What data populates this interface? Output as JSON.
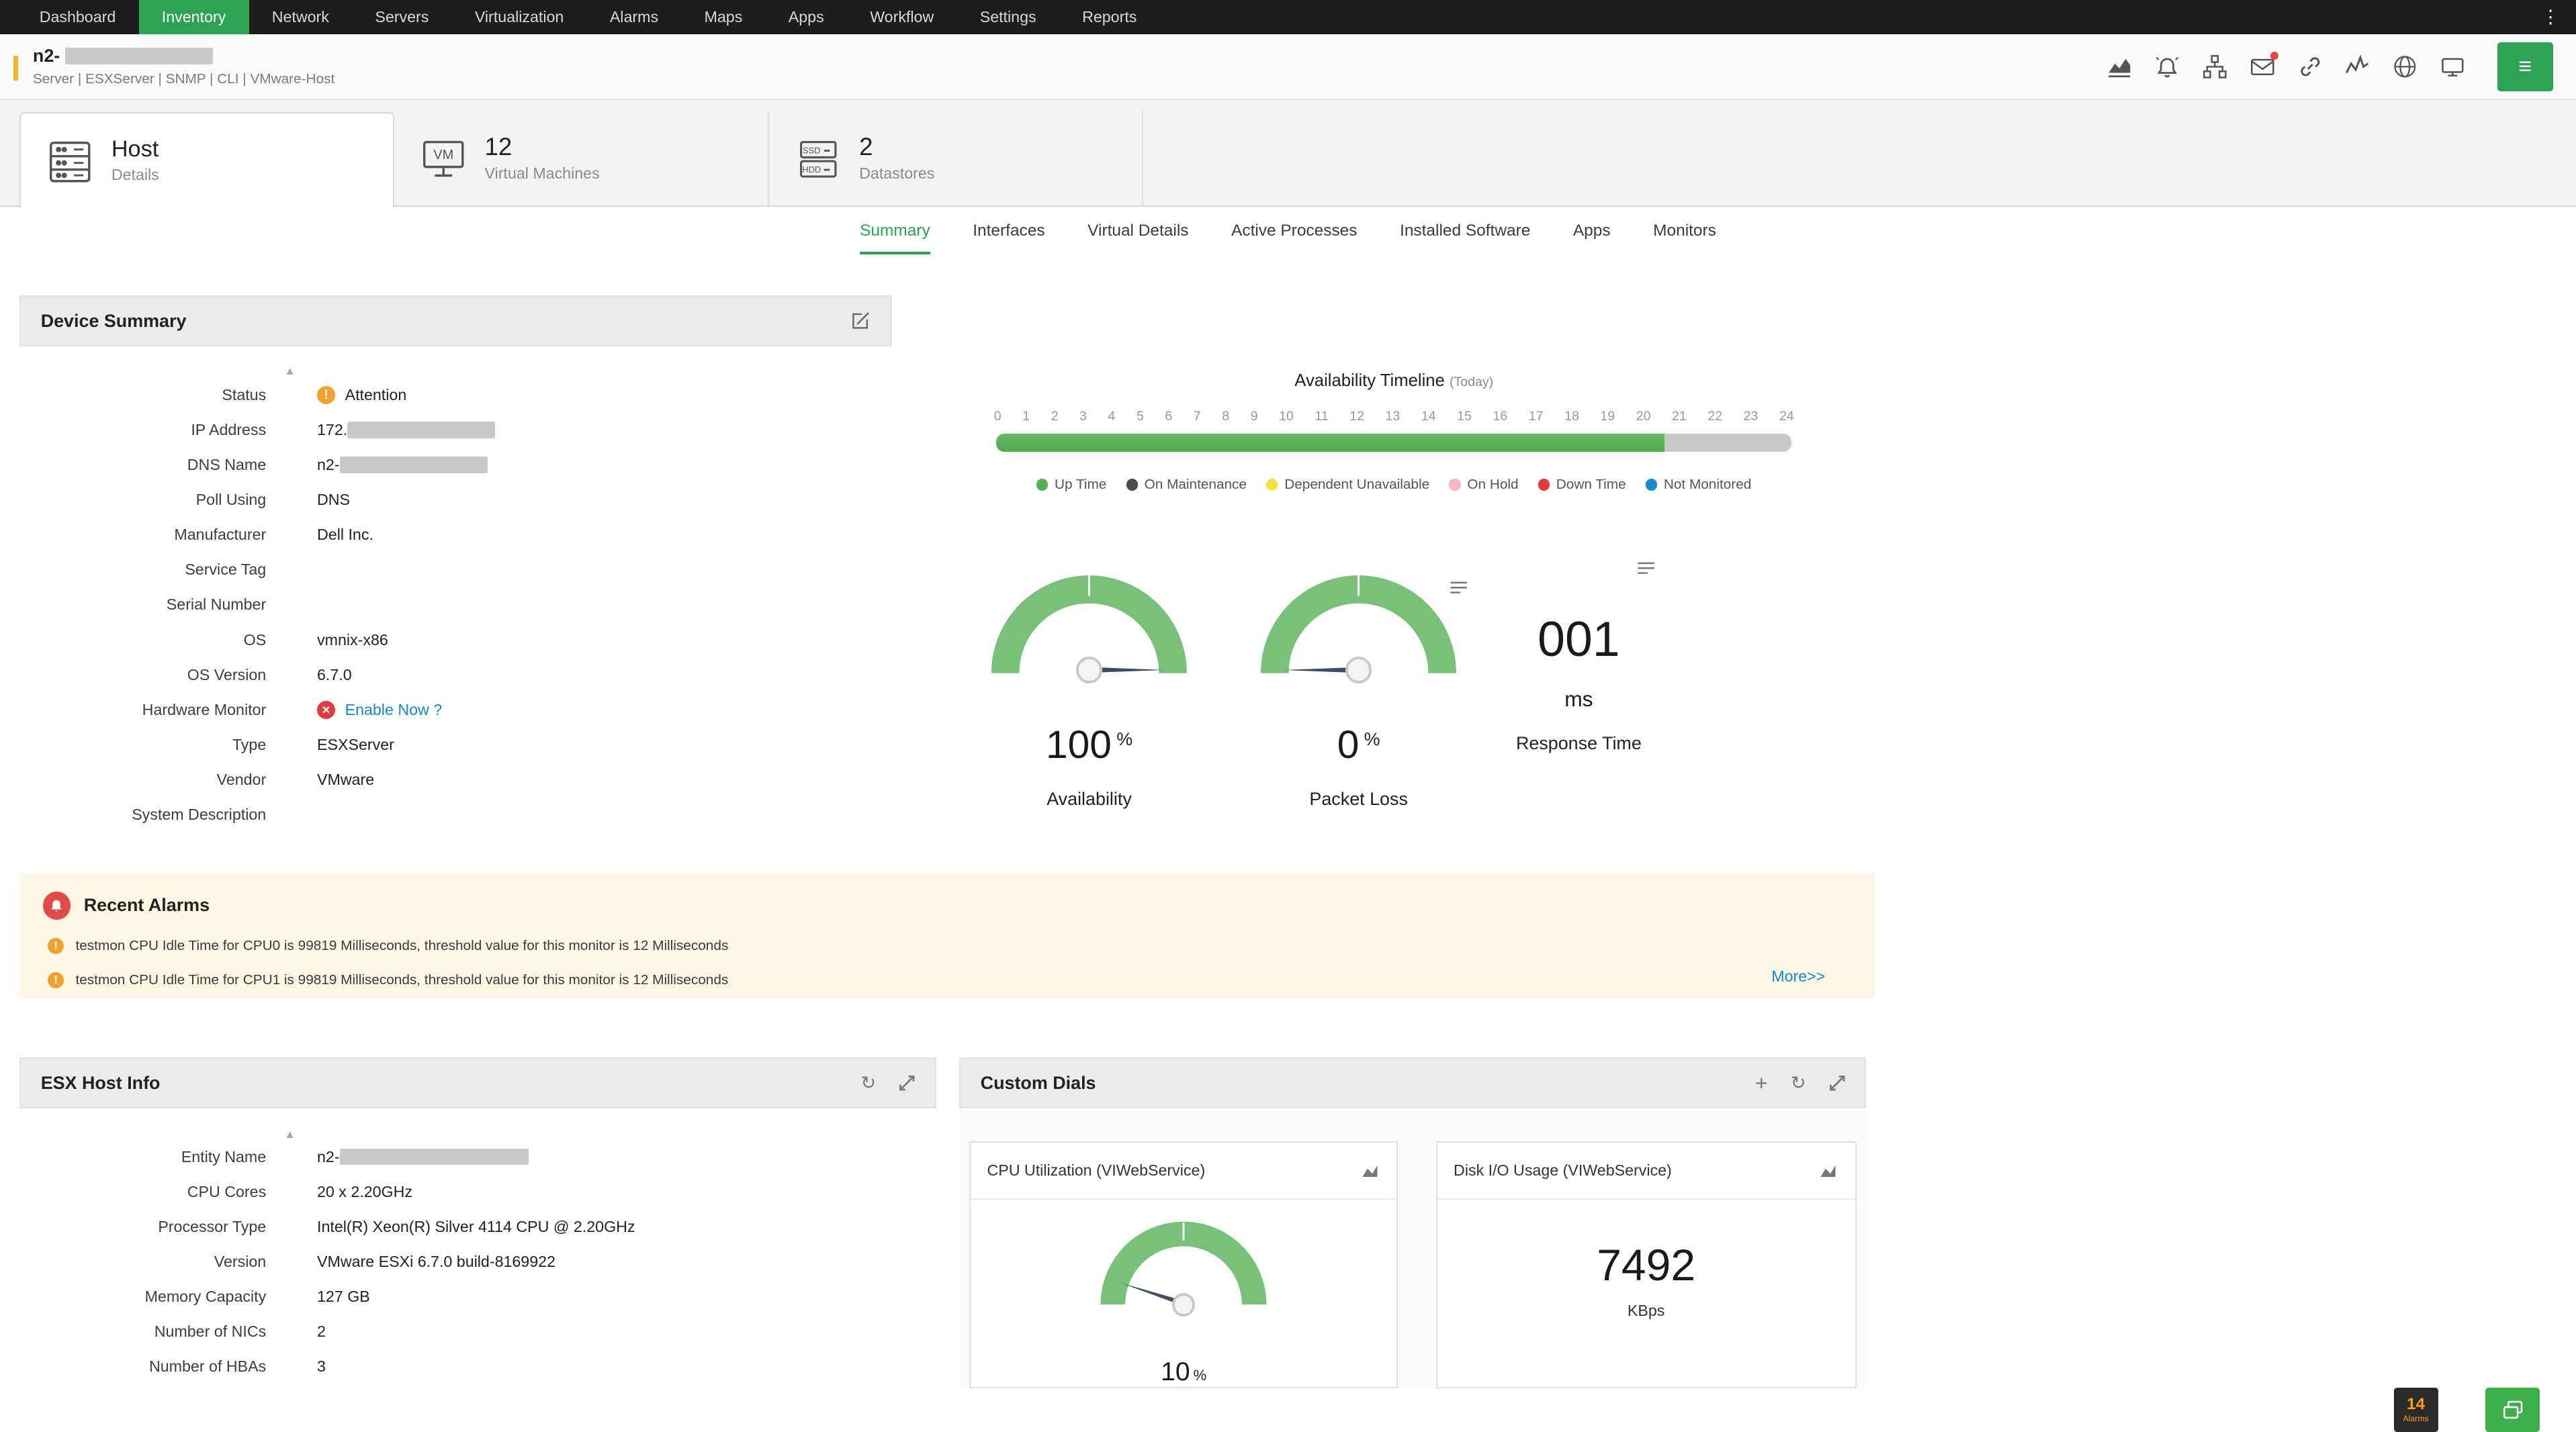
{
  "icons": {
    "menu_dots": "⋮",
    "hamburger": "≡",
    "refresh": "↻",
    "plus": "+",
    "scroll_up": "▲"
  },
  "topnav": {
    "items": [
      {
        "label": "Dashboard"
      },
      {
        "label": "Inventory",
        "active": true
      },
      {
        "label": "Network"
      },
      {
        "label": "Servers"
      },
      {
        "label": "Virtualization"
      },
      {
        "label": "Alarms"
      },
      {
        "label": "Maps"
      },
      {
        "label": "Apps"
      },
      {
        "label": "Workflow"
      },
      {
        "label": "Settings"
      },
      {
        "label": "Reports"
      }
    ]
  },
  "device_header": {
    "name": "n2-",
    "breadcrumb": "Server | ESXServer | SNMP | CLI | VMware-Host"
  },
  "entity_tabs": {
    "host": {
      "title": "Host",
      "subtitle": "Details"
    },
    "vms": {
      "count": "12",
      "label": "Virtual Machines",
      "icon_text": "VM"
    },
    "datastores": {
      "count": "2",
      "label": "Datastores",
      "icon_text_ssd": "SSD",
      "icon_text_hdd": "HDD"
    }
  },
  "subtabs": [
    {
      "label": "Summary",
      "active": true
    },
    {
      "label": "Interfaces"
    },
    {
      "label": "Virtual Details"
    },
    {
      "label": "Active Processes"
    },
    {
      "label": "Installed Software"
    },
    {
      "label": "Apps"
    },
    {
      "label": "Monitors"
    }
  ],
  "device_summary": {
    "title": "Device Summary",
    "fields": [
      {
        "label": "Status",
        "value": "Attention",
        "icon": "warning"
      },
      {
        "label": "IP Address",
        "value": "172.",
        "redacted": true
      },
      {
        "label": "DNS Name",
        "value": "n2-",
        "redacted": true
      },
      {
        "label": "Poll Using",
        "value": "DNS"
      },
      {
        "label": "Manufacturer",
        "value": "Dell Inc."
      },
      {
        "label": "Service Tag",
        "value": ""
      },
      {
        "label": "Serial Number",
        "value": ""
      },
      {
        "label": "OS",
        "value": "vmnix-x86"
      },
      {
        "label": "OS Version",
        "value": "6.7.0"
      },
      {
        "label": "Hardware Monitor",
        "value": "Enable Now ?",
        "icon": "error",
        "link": true
      },
      {
        "label": "Type",
        "value": "ESXServer"
      },
      {
        "label": "Vendor",
        "value": "VMware"
      },
      {
        "label": "System Description",
        "value": ""
      }
    ]
  },
  "availability_timeline": {
    "title": "Availability Timeline",
    "subtitle": "(Today)",
    "ticks": [
      "0",
      "1",
      "2",
      "3",
      "4",
      "5",
      "6",
      "7",
      "8",
      "9",
      "10",
      "11",
      "12",
      "13",
      "14",
      "15",
      "16",
      "17",
      "18",
      "19",
      "20",
      "21",
      "22",
      "23",
      "24"
    ],
    "uptime_percent": 84,
    "legend": [
      {
        "label": "Up Time",
        "color": "#52b157"
      },
      {
        "label": "On Maintenance",
        "color": "#4a4a4a"
      },
      {
        "label": "Dependent Unavailable",
        "color": "#f2e33c"
      },
      {
        "label": "On Hold",
        "color": "#f6b8c1"
      },
      {
        "label": "Down Time",
        "color": "#e23c39"
      },
      {
        "label": "Not Monitored",
        "color": "#1e88d2"
      }
    ]
  },
  "gauges": [
    {
      "label": "Availability",
      "value": "100",
      "unit": "%",
      "percent": 100
    },
    {
      "label": "Packet Loss",
      "value": "0",
      "unit": "%",
      "percent": 0
    },
    {
      "label": "Response Time",
      "value": "001",
      "unit": "ms"
    }
  ],
  "recent_alarms": {
    "title": "Recent Alarms",
    "more_label": "More>>",
    "items": [
      "testmon CPU Idle Time for CPU0 is 99819 Milliseconds, threshold value for this monitor is 12 Milliseconds",
      "testmon CPU Idle Time for CPU1 is 99819 Milliseconds, threshold value for this monitor is 12 Milliseconds"
    ]
  },
  "esx_host_info": {
    "title": "ESX Host Info",
    "fields": [
      {
        "label": "Entity Name",
        "value": "n2-",
        "redacted": true
      },
      {
        "label": "CPU Cores",
        "value": "20 x 2.20GHz"
      },
      {
        "label": "Processor Type",
        "value": "Intel(R) Xeon(R) Silver 4114 CPU @ 2.20GHz"
      },
      {
        "label": "Version",
        "value": "VMware ESXi 6.7.0 build-8169922"
      },
      {
        "label": "Memory Capacity",
        "value": "127 GB"
      },
      {
        "label": "Number of NICs",
        "value": "2"
      },
      {
        "label": "Number of HBAs",
        "value": "3"
      }
    ]
  },
  "custom_dials": {
    "title": "Custom Dials",
    "cpu": {
      "title": "CPU Utilization (VIWebService)",
      "value": "10",
      "unit": "%",
      "percent": 10
    },
    "disk": {
      "title": "Disk I/O Usage (VIWebService)",
      "value": "7492",
      "unit": "KBps"
    }
  },
  "footer": {
    "alarm_count": "14",
    "alarm_label": "Alarms"
  }
}
